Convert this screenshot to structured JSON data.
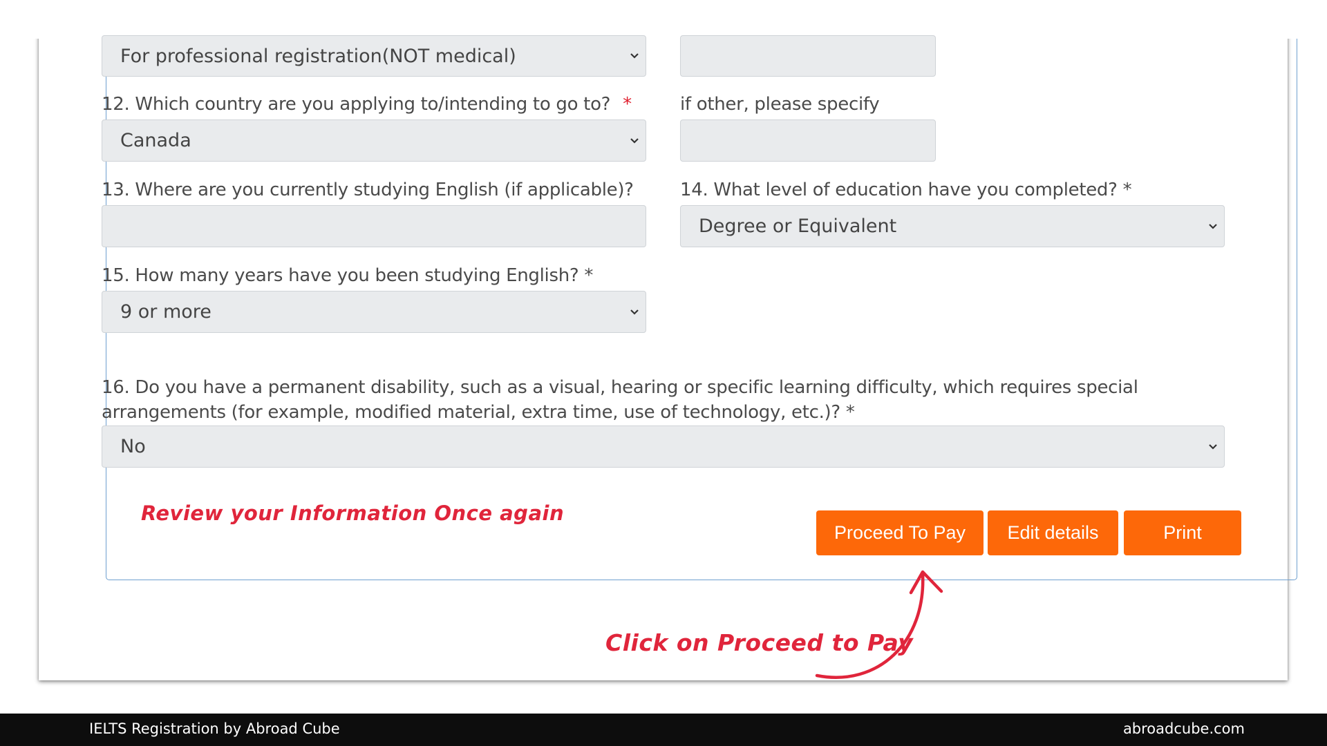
{
  "form": {
    "q11": {
      "selected": "For professional registration(NOT medical)",
      "other_value": ""
    },
    "q12": {
      "label": "12. Which country are you applying to/intending to go to?",
      "required_mark": "*",
      "selected": "Canada"
    },
    "q12_other": {
      "label": "if other, please specify",
      "value": ""
    },
    "q13": {
      "label": "13. Where are you currently studying English (if applicable)?",
      "value": ""
    },
    "q14": {
      "label": "14. What level of education have you completed? *",
      "selected": "Degree or Equivalent"
    },
    "q15": {
      "label": "15. How many years have you been studying English? *",
      "selected": "9 or more"
    },
    "q16": {
      "label": "16. Do you have a permanent disability, such as a visual, hearing or specific learning difficulty, which requires special arrangements (for example, modified material, extra time, use of technology, etc.)? *",
      "selected": "No"
    }
  },
  "buttons": {
    "proceed": "Proceed To Pay",
    "edit": "Edit details",
    "print": "Print"
  },
  "annotations": {
    "review": "Review your Information Once again",
    "click": "Click on Proceed to Pay"
  },
  "footer": {
    "left": "IELTS Registration by Abroad Cube",
    "right": "abroadcube.com"
  },
  "colors": {
    "button": "#fd6809",
    "annotation": "#e0253b",
    "required": "#e0202f"
  },
  "icons": {
    "select_arrow": "chevron-down-icon",
    "pointer": "curved-arrow-icon"
  }
}
